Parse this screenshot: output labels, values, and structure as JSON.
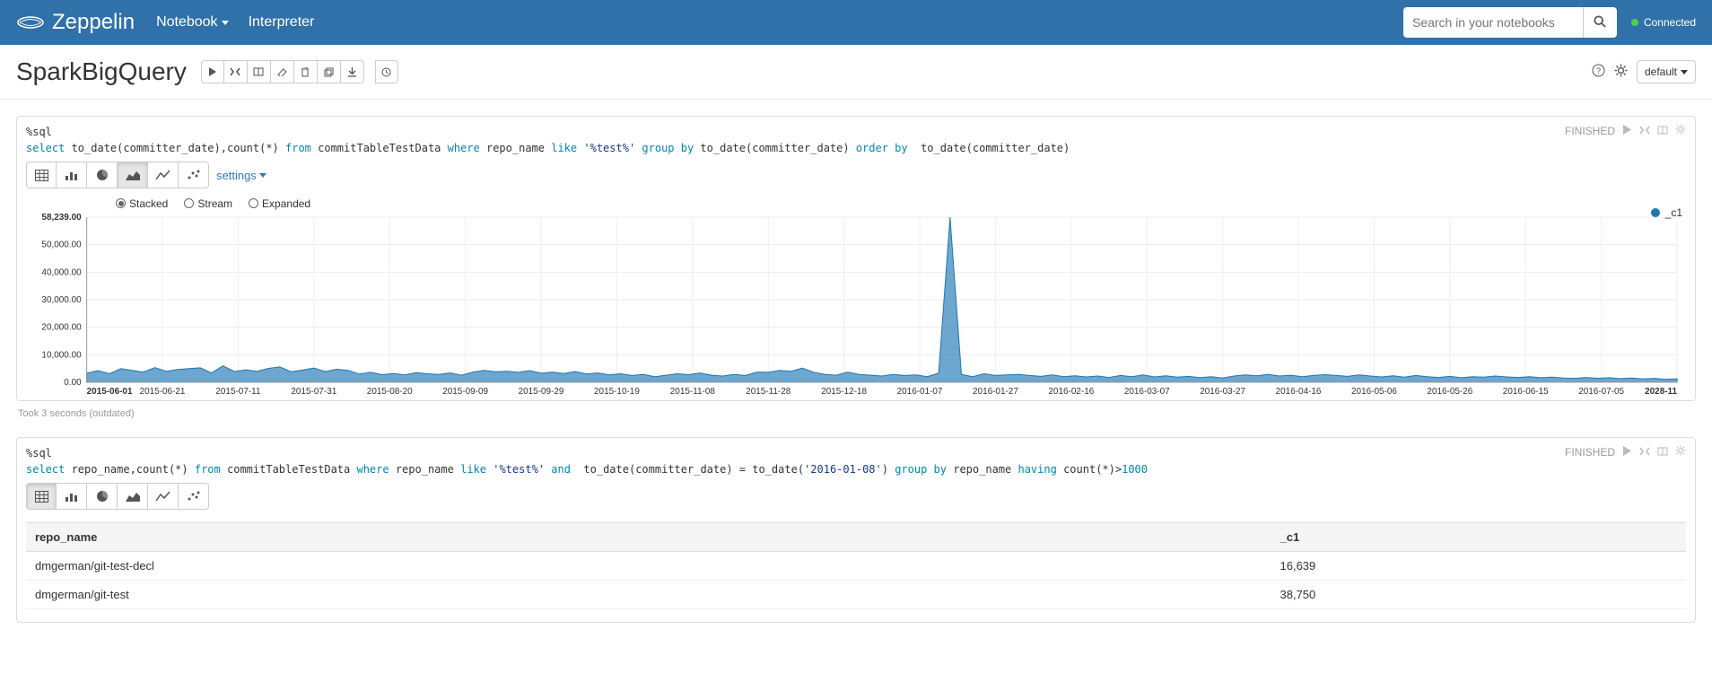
{
  "navbar": {
    "brand": "Zeppelin",
    "links": {
      "notebook": "Notebook",
      "interpreter": "Interpreter"
    },
    "search_placeholder": "Search in your notebooks",
    "connected": "Connected"
  },
  "titlebar": {
    "title": "SparkBigQuery",
    "mode": "default"
  },
  "para1": {
    "status": "FINISHED",
    "percent": "%sql",
    "sql_tokens": [
      "select",
      " to_date(committer_date),count(*) ",
      "from",
      " commitTableTestData ",
      "where",
      " repo_name ",
      "like",
      " ",
      "'%test%'",
      " ",
      "group by",
      " to_date(committer_date) ",
      "order by",
      "  to_date(committer_date)"
    ],
    "settings": "settings",
    "stack_opts": {
      "stacked": "Stacked",
      "stream": "Stream",
      "expanded": "Expanded"
    },
    "took": "Took 3 seconds (outdated)"
  },
  "para2": {
    "status": "FINISHED",
    "percent": "%sql",
    "sql_tokens": [
      "select",
      " repo_name,count(*) ",
      "from",
      " commitTableTestData ",
      "where",
      " repo_name ",
      "like",
      " ",
      "'%test%'",
      " ",
      "and",
      "  to_date(committer_date) = to_date(",
      "'2016-01-08'",
      ") ",
      "group by",
      " repo_name ",
      "having",
      " count(*)>",
      "1000"
    ],
    "headers": {
      "c0": "repo_name",
      "c1": "_c1"
    },
    "rows": [
      {
        "c0": "dmgerman/git-test-decl",
        "c1": "16,639"
      },
      {
        "c0": "dmgerman/git-test",
        "c1": "38,750"
      }
    ]
  },
  "chart_data": {
    "type": "area",
    "title": "",
    "xlabel": "",
    "ylabel": "",
    "ylim": [
      0,
      58239
    ],
    "y_ticks": [
      "0.00",
      "10,000.00",
      "20,000.00",
      "30,000.00",
      "40,000.00",
      "50,000.00",
      "58,239.00"
    ],
    "x_ticks": [
      "2015-06-01",
      "2015-06-21",
      "2015-07-11",
      "2015-07-31",
      "2015-08-20",
      "2015-09-09",
      "2015-09-29",
      "2015-10-19",
      "2015-11-08",
      "2015-11-28",
      "2015-12-18",
      "2016-01-07",
      "2016-01-27",
      "2016-02-16",
      "2016-03-07",
      "2016-03-27",
      "2016-04-16",
      "2016-05-06",
      "2016-05-26",
      "2016-06-15",
      "2016-07-05",
      "2028-11"
    ],
    "series": [
      {
        "name": "_c1",
        "values": [
          3200,
          4100,
          3000,
          4800,
          4200,
          3600,
          5200,
          3900,
          4500,
          4800,
          5100,
          3300,
          5800,
          3800,
          4400,
          3900,
          4900,
          5400,
          3700,
          4300,
          5000,
          3800,
          4600,
          4200,
          2900,
          3500,
          2700,
          3100,
          2600,
          3400,
          3000,
          2800,
          3300,
          2500,
          3600,
          4200,
          3700,
          3900,
          3500,
          4100,
          3200,
          3600,
          3100,
          3800,
          2900,
          3300,
          2600,
          3000,
          2400,
          2800,
          2000,
          2500,
          3000,
          2700,
          3300,
          2500,
          2200,
          2800,
          2400,
          3600,
          3500,
          4200,
          3900,
          5000,
          3500,
          2800,
          2500,
          3600,
          2800,
          2500,
          2200,
          2800,
          2400,
          2600,
          2000,
          3200,
          58239,
          2800,
          2000,
          3000,
          2400,
          2600,
          2800,
          2400,
          2100,
          2600,
          2000,
          2300,
          1900,
          2200,
          1700,
          2400,
          2000,
          2600,
          1900,
          2300,
          1800,
          2100,
          1600,
          2000,
          1500,
          2200,
          2600,
          2300,
          2800,
          2200,
          2500,
          2000,
          2400,
          2700,
          2400,
          2100,
          2600,
          2200,
          1900,
          2300,
          1800,
          2400,
          2000,
          1700,
          2100,
          1600,
          2000,
          1800,
          2200,
          1900,
          1700,
          2000,
          1600,
          1800,
          1500,
          1400,
          1700,
          1400,
          1600,
          1300,
          1500,
          1200,
          1400,
          1000,
          1200
        ]
      }
    ]
  }
}
